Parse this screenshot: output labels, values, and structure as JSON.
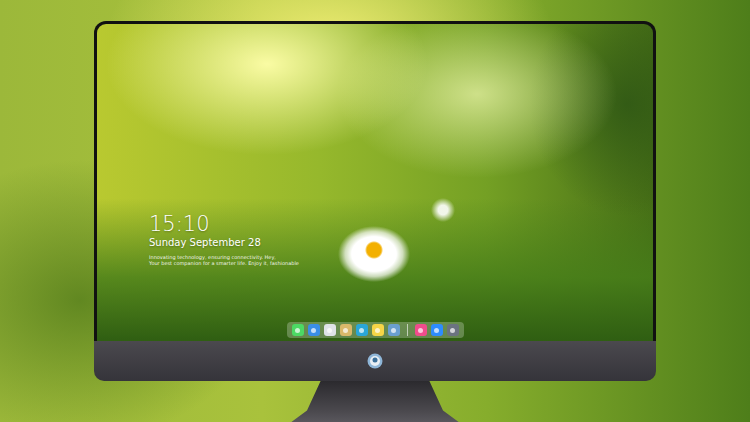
{
  "screen": {
    "clock": {
      "time": "15:10",
      "date": "Sunday September 28"
    },
    "tagline": [
      "Innovating technology, ensuring connectivity. Hey,",
      "Your best companion for a smarter life. Enjoy it, fashionable"
    ]
  },
  "dock": {
    "items": [
      {
        "kind": "app",
        "color": "#4cd964"
      },
      {
        "kind": "app",
        "color": "#3a8ee6"
      },
      {
        "kind": "app",
        "color": "#dfe3e8"
      },
      {
        "kind": "app",
        "color": "#d9b86a"
      },
      {
        "kind": "app",
        "color": "#2aa6d8"
      },
      {
        "kind": "app",
        "color": "#f5d547"
      },
      {
        "kind": "app",
        "color": "#6a9fd0"
      },
      {
        "kind": "separator",
        "color": "#ffffff"
      },
      {
        "kind": "app",
        "color": "#f04c8c"
      },
      {
        "kind": "app",
        "color": "#2d8cff"
      },
      {
        "kind": "app",
        "color": "#6b7380"
      }
    ]
  }
}
